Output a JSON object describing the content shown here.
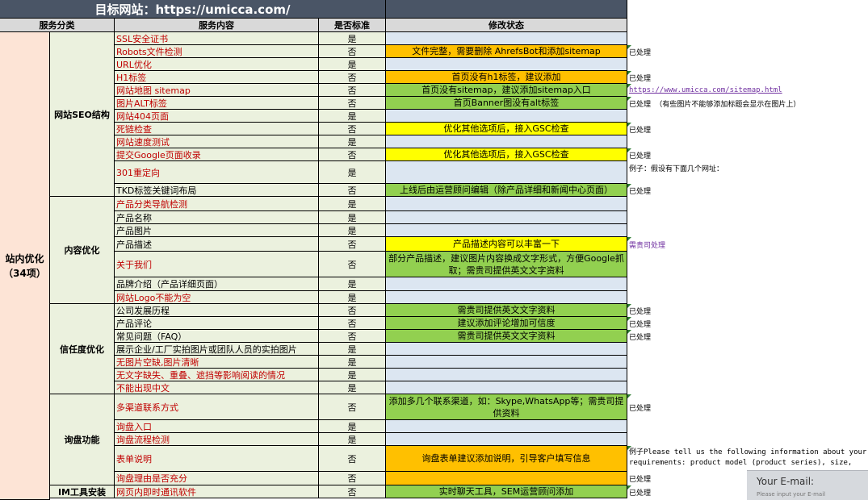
{
  "title": "目标网站：https://umicca.com/",
  "headers": {
    "category": "服务分类",
    "service": "服务内容",
    "standard": "是否标准",
    "status": "修改状态"
  },
  "main_category": {
    "line1": "站内优化",
    "line2": "（34项）"
  },
  "colors": {
    "title_bg": "#4a5566",
    "header_bg": "#d9d9d9",
    "green": "#92d050",
    "orange": "#ffc000",
    "yellow": "#ffff00",
    "blue": "#dce6f1",
    "light_green": "#ebf1de",
    "pink": "#fde4d6"
  },
  "groups": [
    {
      "name": "网站SEO结构",
      "rows": [
        {
          "service": "SSL安全证书",
          "red": true,
          "standard": "是",
          "status": "",
          "status_color": "blue",
          "note": "",
          "note_style": ""
        },
        {
          "service": "Robots文件检测",
          "red": true,
          "standard": "否",
          "status": "文件完整，需要删除 AhrefsBot和添加sitemap",
          "status_color": "orange",
          "note": "已处理",
          "note_style": ""
        },
        {
          "service": "URL优化",
          "red": true,
          "standard": "是",
          "status": "",
          "status_color": "blue",
          "note": "",
          "note_style": ""
        },
        {
          "service": "H1标签",
          "red": true,
          "standard": "否",
          "status": "首页没有h1标签，建议添加",
          "status_color": "orange",
          "note": "已处理",
          "note_style": ""
        },
        {
          "service": "网站地图 sitemap",
          "red": true,
          "standard": "否",
          "status": "首页没有sitemap，建议添加sitemap入口",
          "status_color": "green",
          "note": "https://www.umicca.com/sitemap.html",
          "note_style": "link"
        },
        {
          "service": "图片ALT标签",
          "red": true,
          "standard": "否",
          "status": "首页Banner图没有alt标签",
          "status_color": "green",
          "note": "已处理 （有些图片不能够添加标题会显示在图片上）",
          "note_style": ""
        },
        {
          "service": "网站404页面",
          "red": true,
          "standard": "是",
          "status": "",
          "status_color": "blue",
          "note": "",
          "note_style": ""
        },
        {
          "service": "死链检查",
          "red": true,
          "standard": "否",
          "status": "优化其他选项后，接入GSC检查",
          "status_color": "yellow",
          "note": "已处理",
          "note_style": ""
        },
        {
          "service": "网站速度测试",
          "red": true,
          "standard": "是",
          "status": "",
          "status_color": "blue",
          "note": "",
          "note_style": ""
        },
        {
          "service": "提交Google页面收录",
          "red": true,
          "standard": "否",
          "status": "优化其他选项后，接入GSC检查",
          "status_color": "yellow",
          "note": "已处理",
          "note_style": ""
        },
        {
          "service": "301重定向",
          "red": true,
          "standard": "是",
          "status": "",
          "status_color": "blue",
          "note": "例子：假设有下面几个网址：",
          "note_style": "top"
        },
        {
          "service": "TKD标签关键词布局",
          "red": false,
          "standard": "否",
          "status": "上线后由运营顾问编辑（除产品详细和新闻中心页面）",
          "status_color": "green",
          "note": "已处理",
          "note_style": ""
        }
      ]
    },
    {
      "name": "内容优化",
      "rows": [
        {
          "service": "产品分类导航检测",
          "red": true,
          "standard": "是",
          "status": "",
          "status_color": "blue",
          "note": "",
          "note_style": ""
        },
        {
          "service": "产品名称",
          "red": false,
          "standard": "是",
          "status": "",
          "status_color": "blue",
          "note": "",
          "note_style": ""
        },
        {
          "service": "产品图片",
          "red": false,
          "standard": "是",
          "status": "",
          "status_color": "blue",
          "note": "",
          "note_style": ""
        },
        {
          "service": "产品描述",
          "red": false,
          "standard": "否",
          "status": "产品描述内容可以丰富一下",
          "status_color": "yellow",
          "note": "需贵司处理",
          "note_style": "purple"
        },
        {
          "service": "关于我们",
          "red": true,
          "standard": "否",
          "status": "部分产品描述，建议图片内容换成文字形式，方便Google抓取；需贵司提供英文文字资料",
          "status_color": "green",
          "note": "",
          "note_style": ""
        },
        {
          "service": "品牌介绍（产品详细页面）",
          "red": false,
          "standard": "是",
          "status": "",
          "status_color": "blue",
          "note": "",
          "note_style": ""
        },
        {
          "service": "网站Logo不能为空",
          "red": true,
          "standard": "是",
          "status": "",
          "status_color": "blue",
          "note": "",
          "note_style": ""
        }
      ]
    },
    {
      "name": "信任度优化",
      "rows": [
        {
          "service": "公司发展历程",
          "red": false,
          "standard": "否",
          "status": "需贵司提供英文文字资料",
          "status_color": "green",
          "note": "已处理",
          "note_style": ""
        },
        {
          "service": "产品评论",
          "red": false,
          "standard": "否",
          "status": "建议添加评论增加可信度",
          "status_color": "green",
          "note": "已处理",
          "note_style": ""
        },
        {
          "service": "常见问题（FAQ）",
          "red": false,
          "standard": "否",
          "status": "需贵司提供英文文字资料",
          "status_color": "green",
          "note": "已处理",
          "note_style": ""
        },
        {
          "service": "展示企业/工厂实拍图片或团队人员的实拍图片",
          "red": false,
          "standard": "是",
          "status": "",
          "status_color": "blue",
          "note": "",
          "note_style": ""
        },
        {
          "service": "无图片空缺,图片清晰",
          "red": true,
          "standard": "是",
          "status": "",
          "status_color": "blue",
          "note": "",
          "note_style": ""
        },
        {
          "service": "无文字缺失、重叠、遮挡等影响阅读的情况",
          "red": true,
          "standard": "是",
          "status": "",
          "status_color": "blue",
          "note": "",
          "note_style": ""
        },
        {
          "service": "不能出现中文",
          "red": true,
          "standard": "是",
          "status": "",
          "status_color": "blue",
          "note": "",
          "note_style": ""
        }
      ]
    },
    {
      "name": "询盘功能",
      "rows": [
        {
          "service": "多渠道联系方式",
          "red": true,
          "standard": "否",
          "status": "添加多几个联系渠道，如：Skype,WhatsApp等；需贵司提供资料",
          "status_color": "green",
          "note": "已处理",
          "note_style": ""
        },
        {
          "service": "询盘入口",
          "red": true,
          "standard": "是",
          "status": "",
          "status_color": "blue",
          "note": "",
          "note_style": ""
        },
        {
          "service": "询盘流程检测",
          "red": true,
          "standard": "是",
          "status": "",
          "status_color": "blue",
          "note": "",
          "note_style": ""
        },
        {
          "service": "表单说明",
          "red": true,
          "standard": "否",
          "status": "询盘表单建议添加说明，引导客户填写信息",
          "status_color": "orange",
          "note": "例子Please tell us the following information about your requirements: product model (product series), size,",
          "note_style": "wrap"
        },
        {
          "service": "询盘理由是否充分",
          "red": true,
          "standard": "否",
          "status": "",
          "status_color": "orange",
          "note": "已处理",
          "note_style": ""
        }
      ]
    },
    {
      "name": "IM工具安装",
      "rows": [
        {
          "service": "网页内即时通讯软件",
          "red": true,
          "standard": "否",
          "status": "实时聊天工具，SEM运营顾问添加",
          "status_color": "green",
          "note": "已处理",
          "note_style": ""
        }
      ]
    }
  ],
  "overlay": {
    "title": "Your E-mail:",
    "placeholder": "Please input your E-mail"
  }
}
